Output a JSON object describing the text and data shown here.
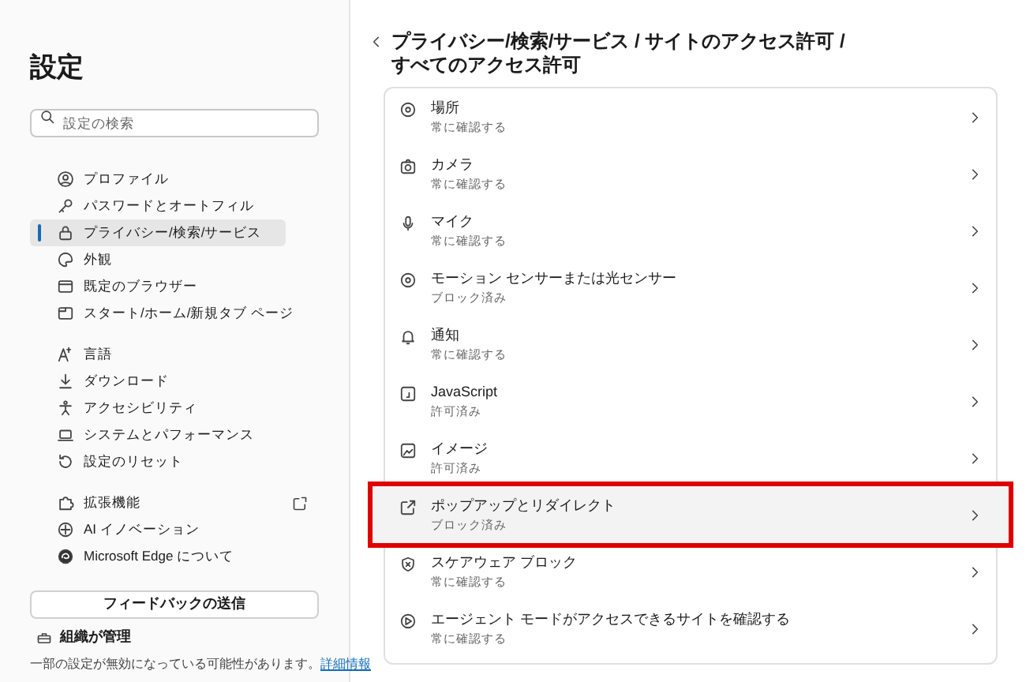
{
  "sidebar": {
    "title": "設定",
    "search": {
      "placeholder": "設定の検索"
    },
    "groups": [
      [
        {
          "label": "プロファイル",
          "selected": false
        },
        {
          "label": "パスワードとオートフィル",
          "selected": false
        },
        {
          "label": "プライバシー/検索/サービス",
          "selected": true
        },
        {
          "label": "外観",
          "selected": false
        },
        {
          "label": "既定のブラウザー",
          "selected": false
        },
        {
          "label": "スタート/ホーム/新規タブ ページ",
          "selected": false
        }
      ],
      [
        {
          "label": "言語",
          "selected": false
        },
        {
          "label": "ダウンロード",
          "selected": false
        },
        {
          "label": "アクセシビリティ",
          "selected": false
        },
        {
          "label": "システムとパフォーマンス",
          "selected": false
        },
        {
          "label": "設定のリセット",
          "selected": false
        }
      ],
      [
        {
          "label": "拡張機能",
          "selected": false,
          "external": true
        },
        {
          "label": "AI イノベーション",
          "selected": false
        },
        {
          "label": "Microsoft Edge について",
          "selected": false
        }
      ]
    ],
    "feedback_button": "フィードバックの送信",
    "managed": "組織が管理",
    "note": "一部の設定が無効になっている可能性があります。",
    "note_link": "詳細情報"
  },
  "heading_lines": [
    "プライバシー/検索/サービス / サイトのアクセス許可 /",
    "すべてのアクセス許可"
  ],
  "permissions": [
    {
      "title": "場所",
      "status": "常に確認する",
      "highlighted": false
    },
    {
      "title": "カメラ",
      "status": "常に確認する",
      "highlighted": false
    },
    {
      "title": "マイク",
      "status": "常に確認する",
      "highlighted": false
    },
    {
      "title": "モーション センサーまたは光センサー",
      "status": "ブロック済み",
      "highlighted": false
    },
    {
      "title": "通知",
      "status": "常に確認する",
      "highlighted": false
    },
    {
      "title": "JavaScript",
      "status": "許可済み",
      "highlighted": false
    },
    {
      "title": "イメージ",
      "status": "許可済み",
      "highlighted": false
    },
    {
      "title": "ポップアップとリダイレクト",
      "status": "ブロック済み",
      "highlighted": true
    },
    {
      "title": "スケアウェア ブロック",
      "status": "常に確認する",
      "highlighted": false
    },
    {
      "title": "エージェント モードがアクセスできるサイトを確認する",
      "status": "常に確認する",
      "highlighted": false
    }
  ]
}
